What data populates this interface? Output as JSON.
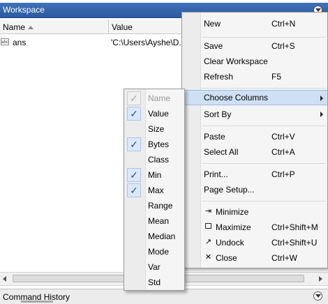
{
  "workspace": {
    "title": "Workspace",
    "columns": {
      "name": "Name",
      "value": "Value"
    },
    "rows": [
      {
        "icon": "abc",
        "name": "ans",
        "value": "'C:\\Users\\Ayshe\\D..."
      }
    ]
  },
  "command_history": {
    "title": "Command History"
  },
  "context_menu": {
    "new": {
      "label": "New",
      "shortcut": "Ctrl+N"
    },
    "save": {
      "label": "Save",
      "shortcut": "Ctrl+S"
    },
    "clear_workspace": {
      "label": "Clear Workspace"
    },
    "refresh": {
      "label": "Refresh",
      "shortcut": "F5"
    },
    "choose_columns": {
      "label": "Choose Columns"
    },
    "sort_by": {
      "label": "Sort By"
    },
    "paste": {
      "label": "Paste",
      "shortcut": "Ctrl+V"
    },
    "select_all": {
      "label": "Select All",
      "shortcut": "Ctrl+A"
    },
    "print": {
      "label": "Print...",
      "shortcut": "Ctrl+P"
    },
    "page_setup": {
      "label": "Page Setup..."
    },
    "minimize": {
      "label": "Minimize",
      "icon": "minimize-icon"
    },
    "maximize": {
      "label": "Maximize",
      "shortcut": "Ctrl+Shift+M",
      "icon": "maximize-icon"
    },
    "undock": {
      "label": "Undock",
      "shortcut": "Ctrl+Shift+U",
      "icon": "undock-icon"
    },
    "close": {
      "label": "Close",
      "shortcut": "Ctrl+W",
      "icon": "close-icon"
    }
  },
  "columns_submenu": [
    {
      "label": "Name",
      "checked": true,
      "disabled": true
    },
    {
      "label": "Value",
      "checked": true
    },
    {
      "label": "Size",
      "checked": false
    },
    {
      "label": "Bytes",
      "checked": true
    },
    {
      "label": "Class",
      "checked": false
    },
    {
      "label": "Min",
      "checked": true
    },
    {
      "label": "Max",
      "checked": true
    },
    {
      "label": "Range",
      "checked": false
    },
    {
      "label": "Mean",
      "checked": false
    },
    {
      "label": "Median",
      "checked": false
    },
    {
      "label": "Mode",
      "checked": false
    },
    {
      "label": "Var",
      "checked": false
    },
    {
      "label": "Std",
      "checked": false
    }
  ],
  "colors": {
    "titlebar": "#2c5aa0",
    "highlight": "#cfe0f5",
    "check": "#1e4fa8"
  }
}
